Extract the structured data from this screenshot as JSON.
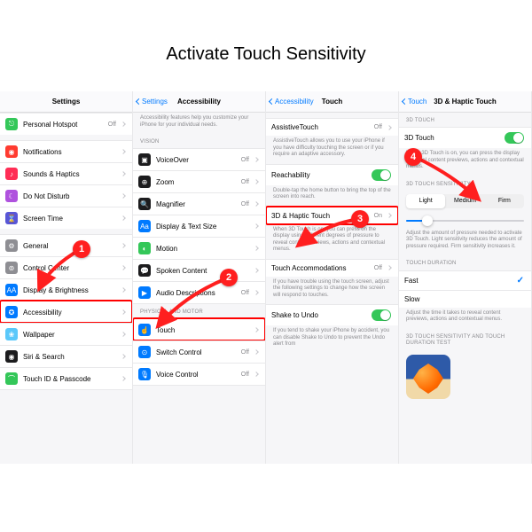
{
  "title": "Activate Touch Sensitivity",
  "badges": [
    "1",
    "2",
    "3",
    "4"
  ],
  "p1": {
    "nav_title": "Settings",
    "items": [
      {
        "icon": "i-green",
        "glyph": "⎋",
        "label": "Personal Hotspot",
        "value": "Off"
      },
      {
        "icon": "i-red",
        "glyph": "◉",
        "label": "Notifications"
      },
      {
        "icon": "i-pink",
        "glyph": "♪",
        "label": "Sounds & Haptics"
      },
      {
        "icon": "i-purple",
        "glyph": "☾",
        "label": "Do Not Disturb"
      },
      {
        "icon": "i-indigo",
        "glyph": "⌛",
        "label": "Screen Time"
      },
      {
        "icon": "i-gray",
        "glyph": "⚙",
        "label": "General"
      },
      {
        "icon": "i-gray",
        "glyph": "⊚",
        "label": "Control Center"
      },
      {
        "icon": "i-blue",
        "glyph": "AA",
        "label": "Display & Brightness"
      },
      {
        "icon": "i-blue",
        "glyph": "✪",
        "label": "Accessibility",
        "hl": true
      },
      {
        "icon": "i-lightblue",
        "glyph": "❀",
        "label": "Wallpaper"
      },
      {
        "icon": "i-black",
        "glyph": "◉",
        "label": "Siri & Search"
      },
      {
        "icon": "i-green",
        "glyph": "⌒",
        "label": "Touch ID & Passcode"
      }
    ]
  },
  "p2": {
    "back": "Settings",
    "nav_title": "Accessibility",
    "intro": "Accessibility features help you customize your iPhone for your individual needs.",
    "g1": "VISION",
    "vision": [
      {
        "icon": "i-black",
        "glyph": "▣",
        "label": "VoiceOver",
        "value": "Off"
      },
      {
        "icon": "i-black",
        "glyph": "⊕",
        "label": "Zoom",
        "value": "Off"
      },
      {
        "icon": "i-black",
        "glyph": "🔍",
        "label": "Magnifier",
        "value": "Off"
      },
      {
        "icon": "i-blue",
        "glyph": "Aa",
        "label": "Display & Text Size"
      },
      {
        "icon": "i-green",
        "glyph": "◐",
        "label": "Motion"
      },
      {
        "icon": "i-black",
        "glyph": "💬",
        "label": "Spoken Content"
      },
      {
        "icon": "i-blue",
        "glyph": "▶",
        "label": "Audio Descriptions",
        "value": "Off"
      }
    ],
    "g2": "PHYSICAL AND MOTOR",
    "motor": [
      {
        "icon": "i-blue",
        "glyph": "☝",
        "label": "Touch",
        "hl": true
      },
      {
        "icon": "i-blue",
        "glyph": "⊙",
        "label": "Switch Control",
        "value": "Off"
      },
      {
        "icon": "i-blue",
        "glyph": "🎙",
        "label": "Voice Control",
        "value": "Off"
      }
    ]
  },
  "p3": {
    "back": "Accessibility",
    "nav_title": "Touch",
    "at_label": "AssistiveTouch",
    "at_value": "Off",
    "at_note": "AssistiveTouch allows you to use your iPhone if you have difficulty touching the screen or if you require an adaptive accessory.",
    "reach_label": "Reachability",
    "reach_note": "Double-tap the home button to bring the top of the screen into reach.",
    "haptic_label": "3D & Haptic Touch",
    "haptic_value": "On",
    "haptic_note": "When 3D Touch is on, you can press on the display using different degrees of pressure to reveal content previews, actions and contextual menus.",
    "ta_label": "Touch Accommodations",
    "ta_value": "Off",
    "ta_note": "If you have trouble using the touch screen, adjust the following settings to change how the screen will respond to touches.",
    "shake_label": "Shake to Undo",
    "shake_note": "If you tend to shake your iPhone by accident, you can disable Shake to Undo to prevent the Undo alert from"
  },
  "p4": {
    "back": "Touch",
    "nav_title": "3D & Haptic Touch",
    "g1": "3D TOUCH",
    "t3d_label": "3D Touch",
    "t3d_note": "When 3D Touch is on, you can press the display to reveal content previews, actions and contextual menus.",
    "g2": "3D TOUCH SENSITIVITY",
    "seg": [
      "Light",
      "Medium",
      "Firm"
    ],
    "seg_note": "Adjust the amount of pressure needed to activate 3D Touch. Light sensitivity reduces the amount of pressure required. Firm sensitivity increases it.",
    "g3": "TOUCH DURATION",
    "fast": "Fast",
    "slow": "Slow",
    "dur_note": "Adjust the time it takes to reveal content previews, actions and contextual menus.",
    "g4": "3D TOUCH SENSITIVITY AND TOUCH DURATION TEST"
  }
}
